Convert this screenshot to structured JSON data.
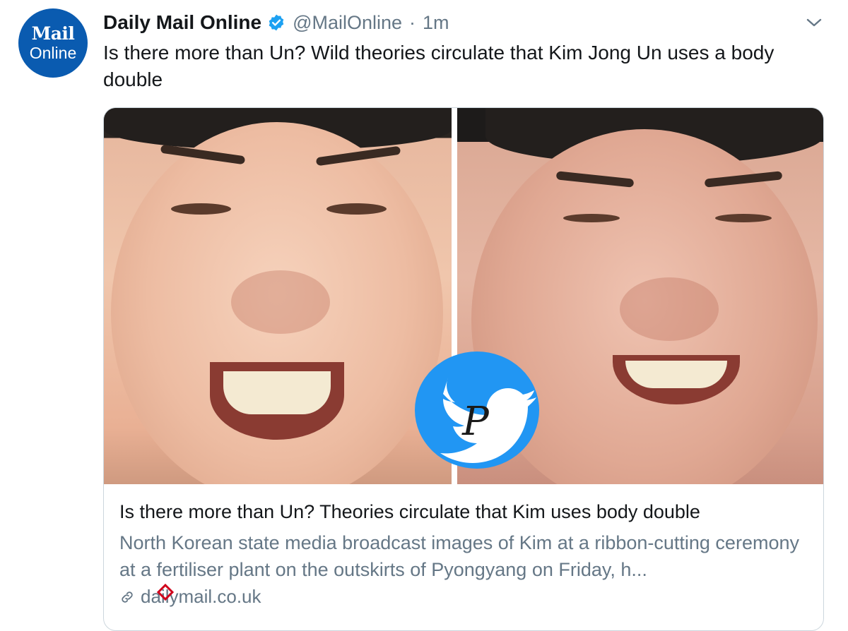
{
  "tweet": {
    "author": {
      "avatar_line1": "Mail",
      "avatar_line2": "Online",
      "name": "Daily Mail Online",
      "verified": true,
      "handle": "@MailOnline",
      "separator": "·",
      "time": "1m"
    },
    "text": "Is there more than Un? Wild theories circulate that Kim Jong Un uses a body double",
    "menu_icon": "chevron-down-icon"
  },
  "card": {
    "title": "Is there more than Un? Theories circulate that Kim uses body double",
    "description": "North Korean state media broadcast images of Kim at a ribbon-cutting ceremony at a fertiliser plant on the outskirts of Pyongyang on Friday, h...",
    "domain": "dailymail.co.uk",
    "link_icon": "link-icon"
  },
  "colors": {
    "avatar_bg": "#0a5bb0",
    "verified": "#1da1f2",
    "secondary_text": "#657786",
    "primary_text": "#14171a",
    "watermark": "#2196f3"
  }
}
